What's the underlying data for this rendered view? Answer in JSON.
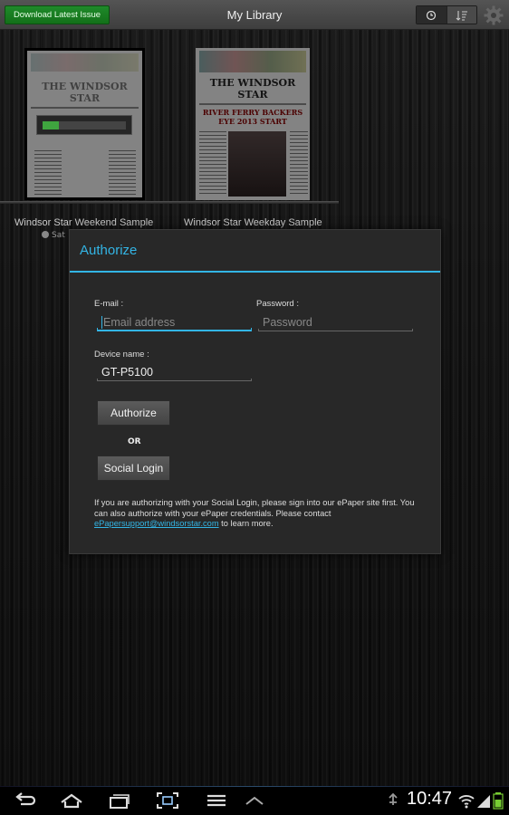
{
  "topbar": {
    "download_label": "Download Latest Issue",
    "title": "My Library",
    "view_toggle": [
      "clock-icon",
      "sort-icon"
    ],
    "settings_icon": "gear-icon"
  },
  "library": {
    "books": [
      {
        "label": "Windsor Star Weekend Sample",
        "masthead": "THE WINDSOR STAR",
        "date_prefix": "Sat",
        "download_progress": 0.2
      },
      {
        "label": "Windsor Star Weekday Sample",
        "masthead": "THE WINDSOR STAR",
        "headline": "RIVER FERRY BACKERS EYE 2013 START"
      }
    ]
  },
  "dialog": {
    "title": "Authorize",
    "email_label": "E-mail :",
    "email_placeholder": "Email address",
    "password_label": "Password :",
    "password_placeholder": "Password",
    "device_label": "Device name :",
    "device_value": "GT-P5100",
    "authorize_button": "Authorize",
    "or_text": "OR",
    "social_button": "Social Login",
    "note_text": "If you are authorizing with your Social Login, please sign into our ePaper site first. You can also authorize with your ePaper credentials. Please contact ",
    "note_link": "ePapersupport@windsorstar.com",
    "note_suffix": " to learn more."
  },
  "system_bar": {
    "icons": [
      "back-icon",
      "home-icon",
      "recent-apps-icon",
      "screenshot-icon",
      "menu-icon",
      "up-icon"
    ],
    "time": "10:47",
    "status_icons": [
      "usb-icon",
      "wifi-icon",
      "signal-icon",
      "battery-icon"
    ],
    "accent": "#33b5e5"
  }
}
